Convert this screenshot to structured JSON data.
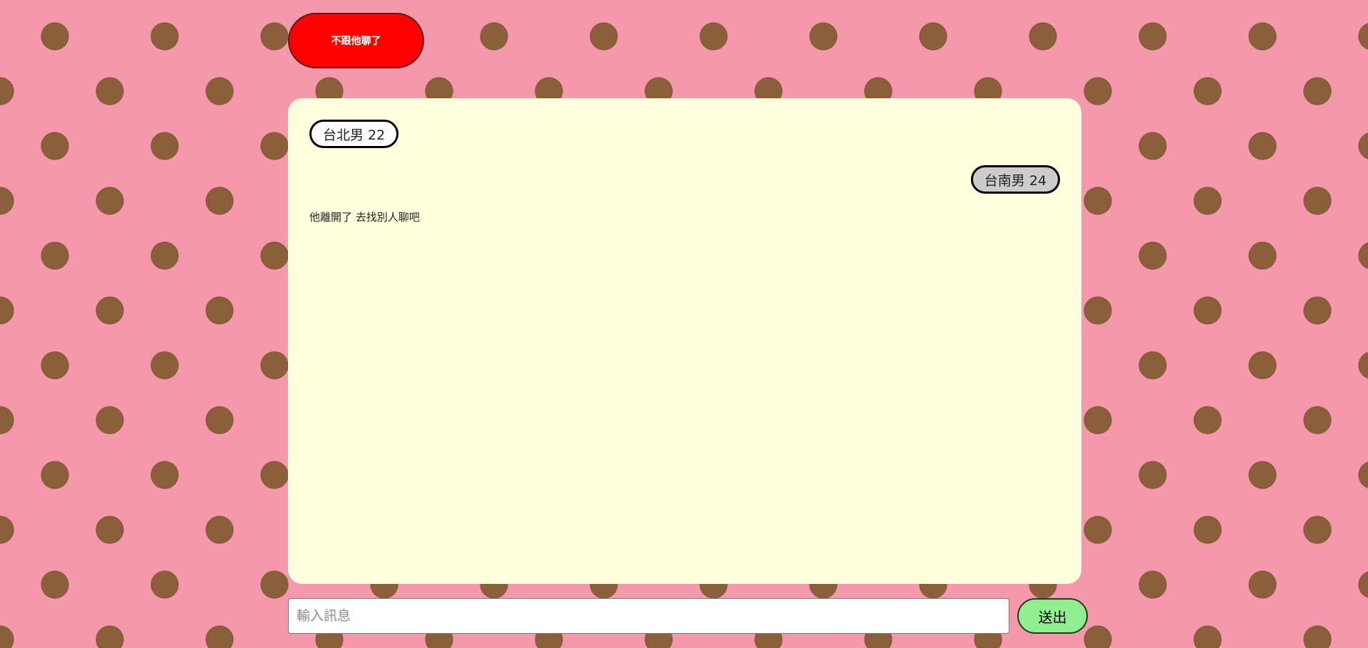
{
  "header": {
    "leave_button_label": "不跟他聊了"
  },
  "chat": {
    "my_tag": "台北男 22",
    "partner_tag": "台南男 24",
    "system_message": "他離開了 去找別人聊吧"
  },
  "composer": {
    "input_value": "",
    "input_placeholder": "輸入訊息",
    "send_button_label": "送出"
  },
  "colors": {
    "background": "#f598ab",
    "polka_dot": "#8c5f3b",
    "chat_panel": "#ffffdd",
    "leave_button": "#ff0000",
    "send_button": "#90ee90",
    "partner_tag": "#cccccc"
  }
}
